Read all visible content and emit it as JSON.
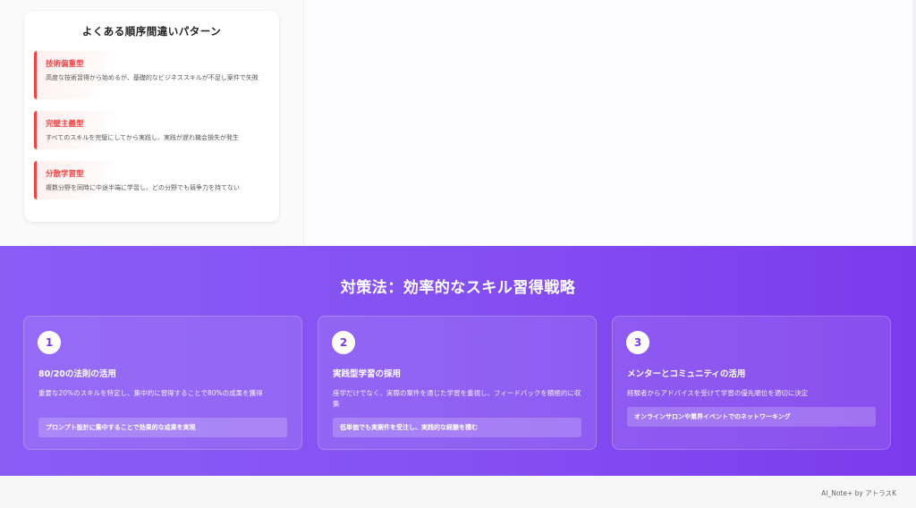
{
  "mistakes": {
    "title": "よくある順序間違いパターン",
    "items": [
      {
        "title": "技術偏重型",
        "desc": "高度な技術習得から始めるが、基礎的なビジネススキルが不足し案件で失敗"
      },
      {
        "title": "完璧主義型",
        "desc": "すべてのスキルを完璧にしてから実践し、実践が遅れ機会損失が発生"
      },
      {
        "title": "分散学習型",
        "desc": "複数分野を同時に中途半端に学習し、どの分野でも競争力を持てない"
      }
    ]
  },
  "strategy": {
    "title": "対策法：効率的なスキル習得戦略",
    "cards": [
      {
        "number": "1",
        "title": "80/20の法則の活用",
        "desc": "重要な20%のスキルを特定し、集中的に習得することで80%の成果を獲得",
        "note": "プロンプト設計に集中することで効果的な成果を実現"
      },
      {
        "number": "2",
        "title": "実践型学習の採用",
        "desc": "座学だけでなく、実際の案件を通じた学習を重視し、フィードバックを積極的に収集",
        "note": "低単価でも実案件を受注し、実践的な経験を積む"
      },
      {
        "number": "3",
        "title": "メンターとコミュニティの活用",
        "desc": "経験者からアドバイスを受けて学習の優先順位を適切に決定",
        "note": "オンラインサロンや業界イベントでのネットワーキング"
      }
    ]
  },
  "footer": {
    "credit": "AI_Note+ by アトラスK"
  },
  "colors": {
    "accent": "#8b5cf6",
    "warning": "#ef4444"
  }
}
